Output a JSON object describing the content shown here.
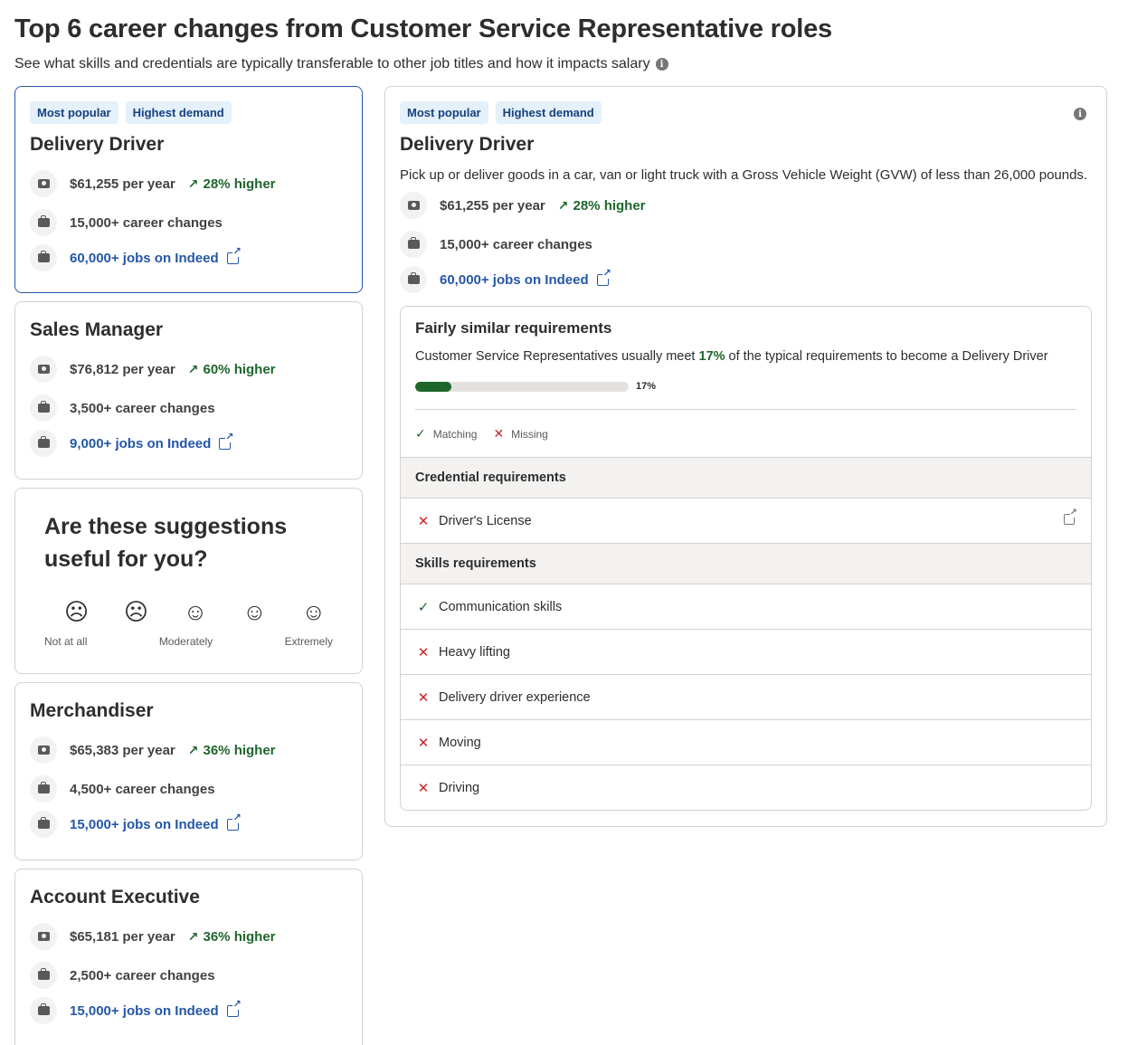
{
  "page": {
    "title": "Top 6 career changes from Customer Service Representative roles",
    "subtitle": "See what skills and credentials are typically transferable to other job titles and how it impacts salary",
    "info_icon": "info-icon"
  },
  "cards": [
    {
      "badges": [
        "Most popular",
        "Highest demand"
      ],
      "title": "Delivery Driver",
      "salary": "$61,255 per year",
      "trend": "28% higher",
      "career_changes": "15,000+ career changes",
      "jobs_link": "60,000+ jobs on Indeed"
    },
    {
      "title": "Sales Manager",
      "salary": "$76,812 per year",
      "trend": "60% higher",
      "career_changes": "3,500+ career changes",
      "jobs_link": "9,000+ jobs on Indeed"
    },
    {
      "title": "Merchandiser",
      "salary": "$65,383 per year",
      "trend": "36% higher",
      "career_changes": "4,500+ career changes",
      "jobs_link": "15,000+ jobs on Indeed"
    },
    {
      "title": "Account Executive",
      "salary": "$65,181 per year",
      "trend": "36% higher",
      "career_changes": "2,500+ career changes",
      "jobs_link": "15,000+ jobs on Indeed"
    }
  ],
  "survey": {
    "question": "Are these suggestions useful for you?",
    "faces": [
      "☹",
      "☹",
      "☺",
      "☺",
      "☺"
    ],
    "labels": {
      "low": "Not at all",
      "mid": "Moderately",
      "high": "Extremely"
    }
  },
  "detail": {
    "badges": [
      "Most popular",
      "Highest demand"
    ],
    "title": "Delivery Driver",
    "description": "Pick up or deliver goods in a car, van or light truck with a Gross Vehicle Weight (GVW) of less than 26,000 pounds.",
    "salary": "$61,255 per year",
    "trend": "28% higher",
    "career_changes": "15,000+ career changes",
    "jobs_link": "60,000+ jobs on Indeed",
    "requirements": {
      "title": "Fairly similar requirements",
      "desc_before": "Customer Service Representatives usually meet ",
      "desc_pct": "17%",
      "desc_after": " of the typical requirements to become a Delivery Driver",
      "progress_percent": 17,
      "progress_label": "17%",
      "legend_matching": "Matching",
      "legend_missing": "Missing",
      "credential_header": "Credential requirements",
      "credentials": [
        {
          "label": "Driver's License",
          "status": "missing"
        }
      ],
      "skills_header": "Skills requirements",
      "skills": [
        {
          "label": "Communication skills",
          "status": "matching"
        },
        {
          "label": "Heavy lifting",
          "status": "missing"
        },
        {
          "label": "Delivery driver experience",
          "status": "missing"
        },
        {
          "label": "Moving",
          "status": "missing"
        },
        {
          "label": "Driving",
          "status": "missing"
        }
      ]
    }
  },
  "colors": {
    "accent": "#2557a7",
    "positive": "#1f662c",
    "negative": "#c9252c",
    "badge_bg": "#e4f0fa"
  }
}
